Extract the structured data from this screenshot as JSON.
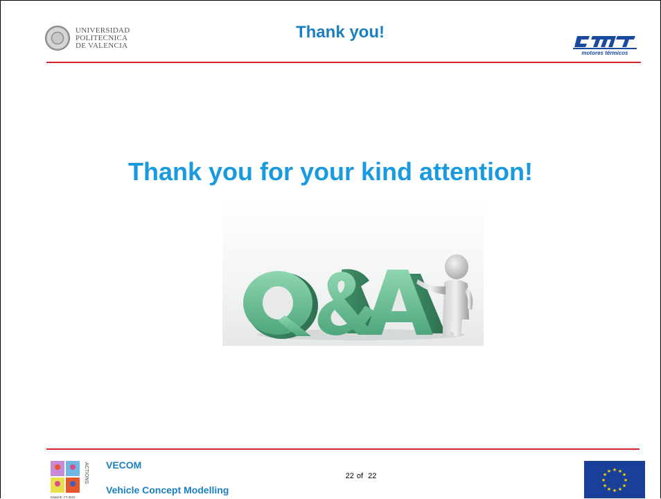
{
  "header": {
    "university_logo": [
      "UNIVERSIDAD",
      "POLITECNICA",
      "DE VALENCIA"
    ],
    "title": "Thank you!",
    "cmt_logo_mark": "CMT",
    "cmt_logo_sub": "motores térmicos"
  },
  "main": {
    "heading": "Thank you for your kind attention!",
    "image_text": "Q&A"
  },
  "footer": {
    "project": "VECOM",
    "project_full": "Vehicle Concept Modelling",
    "page_current": "22",
    "page_of": "of",
    "page_total": "22",
    "mca_logo_text": [
      "MARIE CURIE",
      "ACTIONS"
    ]
  },
  "colors": {
    "title_blue": "#1a7fc0",
    "heading_blue": "#1a9ade",
    "rule_red": "#d8232a",
    "qa_green": "#6fc29a",
    "eu_blue": "#1a3f99",
    "eu_star": "#ffdd00"
  }
}
